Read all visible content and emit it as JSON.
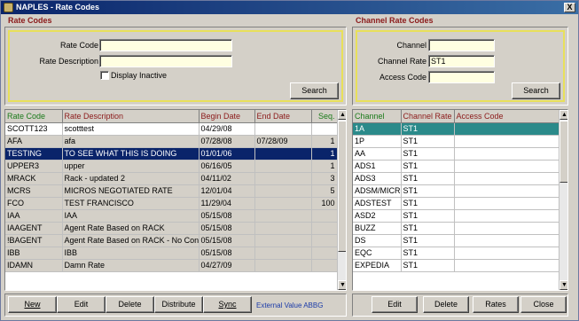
{
  "window": {
    "title": "NAPLES - Rate Codes",
    "close_label": "X"
  },
  "rate_codes": {
    "section_title": "Rate Codes",
    "rate_code_label": "Rate Code",
    "rate_code_value": "",
    "rate_description_label": "Rate Description",
    "rate_description_value": "",
    "display_inactive_label": "Display Inactive",
    "search_label": "Search",
    "columns": [
      "Rate Code",
      "Rate Description",
      "Begin Date",
      "End Date",
      "Seq."
    ],
    "rows": [
      [
        "SCOTT123",
        "scotttest",
        "04/29/08",
        "",
        ""
      ],
      [
        "AFA",
        "afa",
        "07/28/08",
        "07/28/09",
        "1"
      ],
      [
        "TESTING",
        "TO SEE WHAT THIS IS DOING",
        "01/01/06",
        "",
        "1"
      ],
      [
        "UPPER3",
        "upper",
        "06/16/05",
        "",
        "1"
      ],
      [
        "MRACK",
        "Rack - updated 2",
        "04/11/02",
        "",
        "3"
      ],
      [
        "MCRS",
        "MICROS NEGOTIATED RATE",
        "12/01/04",
        "",
        "5"
      ],
      [
        "FCO",
        "TEST FRANCISCO",
        "11/29/04",
        "",
        "100"
      ],
      [
        "IAA",
        "IAA",
        "05/15/08",
        "",
        ""
      ],
      [
        "IAAGENT",
        "Agent Rate Based on RACK",
        "05/15/08",
        "",
        ""
      ],
      [
        "!BAGENT",
        "Agent Rate Based on RACK - No Con",
        "05/15/08",
        "",
        ""
      ],
      [
        "IBB",
        "IBB",
        "05/15/08",
        "",
        ""
      ],
      [
        "IDAMN",
        "Damn Rate",
        "04/27/09",
        "",
        ""
      ]
    ],
    "buttons": [
      "New",
      "Edit",
      "Delete",
      "Distribute",
      "Sync"
    ],
    "external_value": "External Value ABBG"
  },
  "channel_rate_codes": {
    "section_title": "Channel Rate Codes",
    "channel_label": "Channel",
    "channel_value": "",
    "channel_rate_label": "Channel Rate",
    "channel_rate_value": "ST1",
    "access_code_label": "Access Code",
    "access_code_value": "",
    "search_label": "Search",
    "columns": [
      "Channel",
      "Channel Rate",
      "Access Code"
    ],
    "rows": [
      [
        "1A",
        "ST1",
        ""
      ],
      [
        "1P",
        "ST1",
        ""
      ],
      [
        "AA",
        "ST1",
        ""
      ],
      [
        "ADS1",
        "ST1",
        ""
      ],
      [
        "ADS3",
        "ST1",
        ""
      ],
      [
        "ADSM/MICROS",
        "ST1",
        ""
      ],
      [
        "ADSTEST",
        "ST1",
        ""
      ],
      [
        "ASD2",
        "ST1",
        ""
      ],
      [
        "BUZZ",
        "ST1",
        ""
      ],
      [
        "DS",
        "ST1",
        ""
      ],
      [
        "EQC",
        "ST1",
        ""
      ],
      [
        "EXPEDIA",
        "ST1",
        ""
      ]
    ],
    "buttons": [
      "Edit",
      "Delete",
      "Rates",
      "Close"
    ]
  }
}
